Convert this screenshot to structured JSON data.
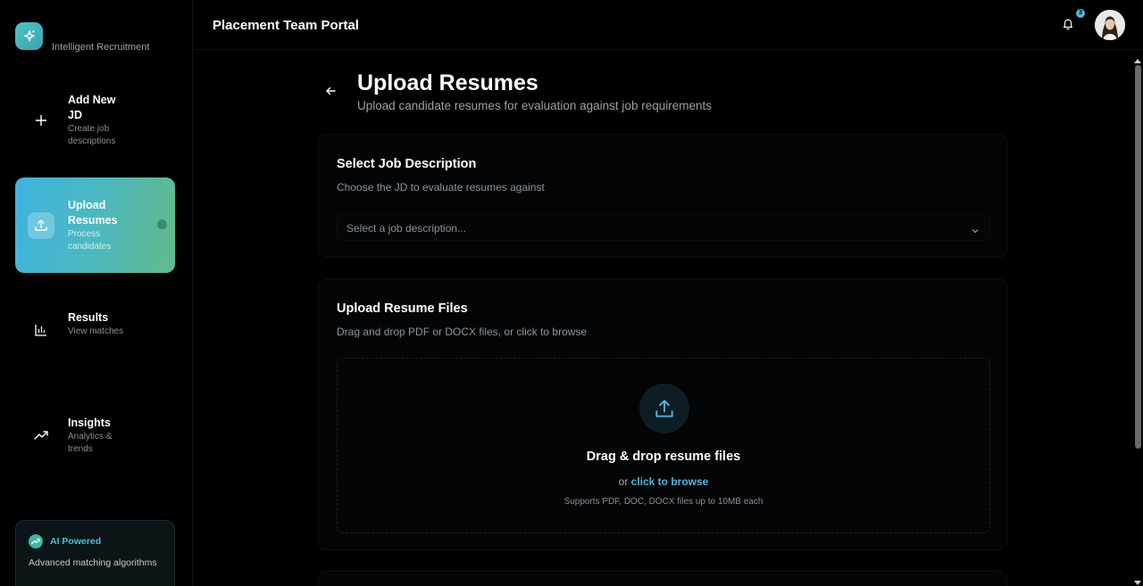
{
  "brand": {
    "subtitle": "Intelligent Recruitment"
  },
  "sidebar": {
    "items": [
      {
        "title": "Add New JD",
        "sub": "Create job descriptions"
      },
      {
        "title": "Upload Resumes",
        "sub": "Process candidates"
      },
      {
        "title": "Results",
        "sub": "View matches"
      },
      {
        "title": "Insights",
        "sub": "Analytics & trends"
      }
    ],
    "ai_card": {
      "title": "AI Powered",
      "desc": "Advanced matching algorithms"
    }
  },
  "header": {
    "title": "Placement Team Portal",
    "notification_count": "3"
  },
  "page": {
    "title": "Upload Resumes",
    "subtitle": "Upload candidate resumes for evaluation against job requirements"
  },
  "jd_card": {
    "title": "Select Job Description",
    "sub": "Choose the JD to evaluate resumes against",
    "select_placeholder": "Select a job description..."
  },
  "upload_card": {
    "title": "Upload Resume Files",
    "sub": "Drag and drop PDF or DOCX files, or click to browse",
    "dz_title": "Drag & drop resume files",
    "dz_or": "or",
    "dz_link": "click to browse",
    "dz_support": "Supports PDF, DOC, DOCX files up to 10MB each"
  },
  "colors": {
    "accent": "#4cb8df",
    "active_gradient_start": "#3fb4e0",
    "active_gradient_end": "#62b98a"
  }
}
